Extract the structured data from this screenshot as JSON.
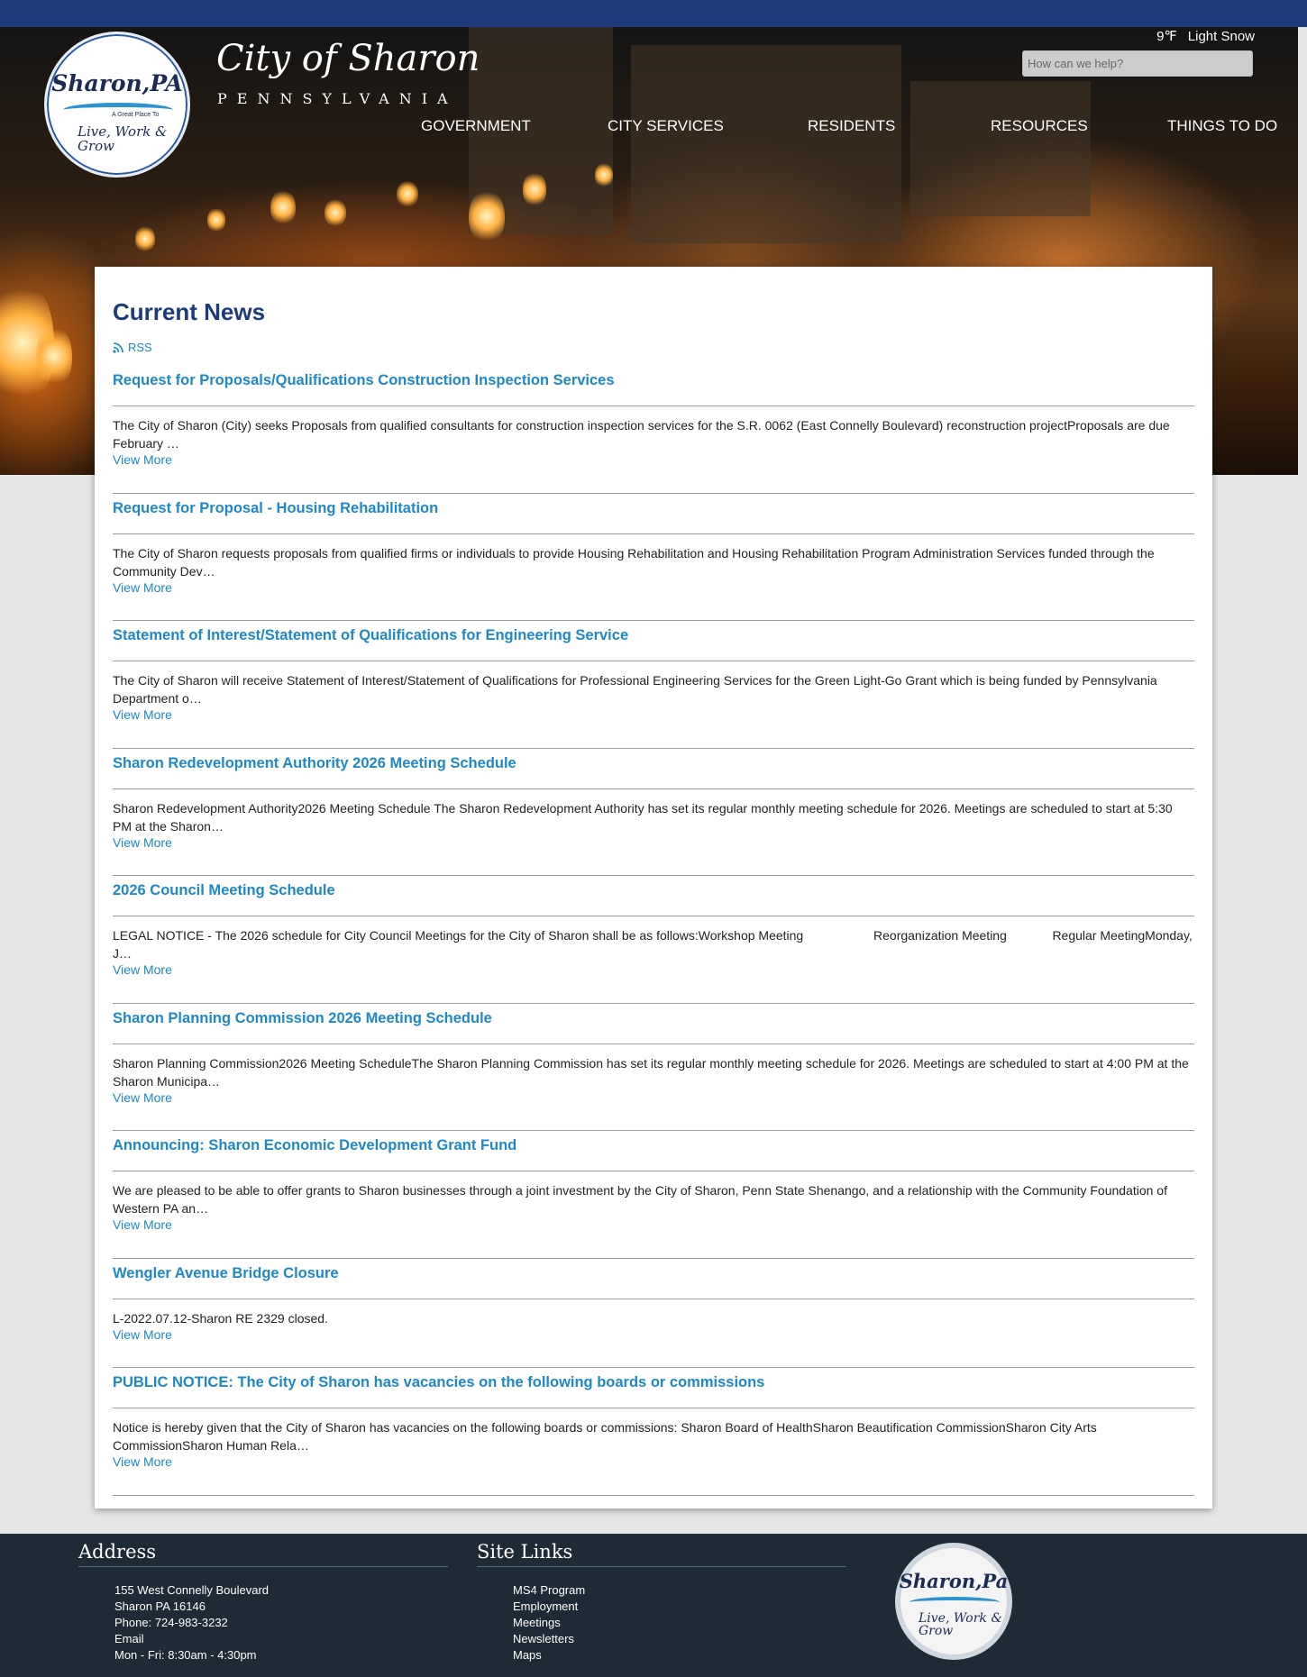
{
  "header": {
    "logo_text": "Sharon,PA",
    "logo_tagline": "A Great Place To",
    "logo_motto": "Live, Work & Grow",
    "title": "City of Sharon",
    "subtitle": "PENNSYLVANIA",
    "weather_temp": "9℉",
    "weather_condition": "Light Snow",
    "search_placeholder": "How can we help?"
  },
  "nav": {
    "items": [
      {
        "label": "GOVERNMENT"
      },
      {
        "label": "CITY SERVICES"
      },
      {
        "label": "RESIDENTS"
      },
      {
        "label": "RESOURCES"
      },
      {
        "label": "THINGS TO DO"
      }
    ]
  },
  "main": {
    "heading": "Current News",
    "rss_label": "RSS",
    "view_more_label": "View More",
    "news": [
      {
        "title": "Request for Proposals/Qualifications Construction Inspection Services",
        "summary": "The City of Sharon (City) seeks Proposals from qualified consultants for construction inspection services for the S.R. 0062 (East Connelly Boulevard) reconstruction projectProposals are due February …"
      },
      {
        "title": "Request for Proposal - Housing Rehabilitation",
        "summary": "The City of Sharon requests proposals from qualified firms or individuals to provide Housing Rehabilitation and Housing Rehabilitation Program Administration Services funded through the Community Dev…"
      },
      {
        "title": "Statement of Interest/Statement of Qualifications for Engineering Service",
        "summary": "The City of Sharon will receive Statement of Interest/Statement of Qualifications for Professional Engineering Services for the Green Light-Go Grant which is being funded by Pennsylvania Department o…"
      },
      {
        "title": "Sharon Redevelopment Authority 2026 Meeting Schedule",
        "summary": "Sharon Redevelopment Authority2026 Meeting Schedule The Sharon Redevelopment Authority has set its regular monthly meeting schedule for 2026.  Meetings are scheduled to start at 5:30 PM at the Sharon…"
      },
      {
        "title": "2026 Council Meeting Schedule",
        "summary": "LEGAL NOTICE - The 2026 schedule for City Council Meetings for the City of Sharon shall be as follows:Workshop Meeting                    Reorganization Meeting             Regular MeetingMonday, J…"
      },
      {
        "title": "Sharon Planning Commission 2026 Meeting Schedule",
        "summary": "Sharon Planning Commission2026 Meeting ScheduleThe Sharon Planning Commission has set its regular monthly meeting schedule for 2026.  Meetings are scheduled to start at 4:00 PM at the Sharon Municipa…"
      },
      {
        "title": "Announcing: Sharon Economic Development Grant Fund",
        "summary": "We are pleased to be able to offer grants to Sharon businesses through a joint investment by the City of Sharon, Penn State Shenango, and a relationship with the Community Foundation of Western PA an…"
      },
      {
        "title": "Wengler Avenue Bridge Closure",
        "summary": "L-2022.07.12-Sharon RE 2329 closed."
      },
      {
        "title": "PUBLIC NOTICE: The City of Sharon has vacancies on the following boards or commissions",
        "summary": "Notice is hereby given that the City of Sharon has vacancies on the following boards or commissions: Sharon Board of HealthSharon Beautification CommissionSharon City Arts CommissionSharon Human Rela…"
      }
    ]
  },
  "footer": {
    "address_heading": "Address",
    "address_lines": [
      "155 West Connelly Boulevard",
      "Sharon PA 16146",
      "Phone: 724-983-3232",
      "Email",
      "Mon - Fri: 8:30am - 4:30pm"
    ],
    "links_heading": "Site Links",
    "links": [
      "MS4 Program",
      "Employment",
      "Meetings",
      "Newsletters",
      "Maps"
    ],
    "logo_text": "Sharon,Pa",
    "logo_motto": "Live, Work & Grow"
  },
  "colors": {
    "brand_blue": "#1d3a7b",
    "link_blue": "#1e88c8",
    "footer_bg": "#1e2a35"
  }
}
